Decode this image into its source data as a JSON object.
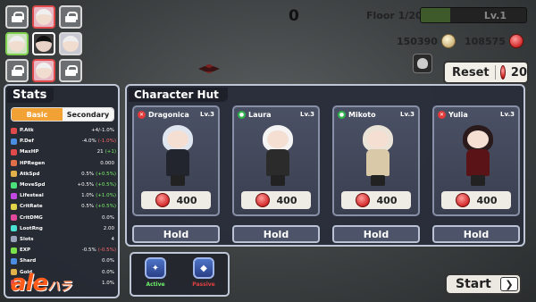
{
  "hud": {
    "score": "0",
    "floor": "Floor 1/20",
    "level": "Lv.1",
    "level_progress": 0.28,
    "gold": "150390",
    "gems": "108575",
    "reset_label": "Reset",
    "reset_cost": "20"
  },
  "squad": [
    {
      "type": "locked"
    },
    {
      "type": "hero",
      "tint": "r"
    },
    {
      "type": "locked"
    },
    {
      "type": "hero",
      "tint": "g"
    },
    {
      "type": "hero",
      "tint": "k"
    },
    {
      "type": "hero",
      "tint": "w"
    },
    {
      "type": "locked"
    },
    {
      "type": "hero",
      "tint": "r"
    },
    {
      "type": "locked"
    }
  ],
  "stats": {
    "title": "Stats",
    "tabs": {
      "basic": "Basic",
      "secondary": "Secondary"
    },
    "rows": [
      {
        "name": "P.Atk",
        "value": "+4/-1.0%",
        "delta": "",
        "color": "#e14a4a"
      },
      {
        "name": "P.Def",
        "value": "-4.0%",
        "delta": "(-1.0%)",
        "color": "#4a8de1"
      },
      {
        "name": "MaxHP",
        "value": "21",
        "delta": "(+1)",
        "pos": true,
        "color": "#e14a4a"
      },
      {
        "name": "HPRegen",
        "value": "0.000",
        "delta": "",
        "color": "#e1704a"
      },
      {
        "name": "AtkSpd",
        "value": "0.5%",
        "delta": "(+0.5%)",
        "pos": true,
        "color": "#e1b14a"
      },
      {
        "name": "MoveSpd",
        "value": "+0.5%",
        "delta": "(+0.5%)",
        "pos": true,
        "color": "#4ae17a"
      },
      {
        "name": "Lifesteal",
        "value": "1.0%",
        "delta": "(+1.0%)",
        "pos": true,
        "color": "#c04ae1"
      },
      {
        "name": "CritRate",
        "value": "0.5%",
        "delta": "(+0.5%)",
        "pos": true,
        "color": "#e1d44a"
      },
      {
        "name": "CritDMG",
        "value": "0.0%",
        "delta": "",
        "color": "#e14a9a"
      },
      {
        "name": "LootRng",
        "value": "2.00",
        "delta": "",
        "color": "#4ae1d4"
      },
      {
        "name": "Slots",
        "value": "4",
        "delta": "",
        "color": "#9aa3b8"
      },
      {
        "name": "EXP",
        "value": "-0.5%",
        "delta": "(-0.5%)",
        "color": "#7ae14a"
      },
      {
        "name": "Shard",
        "value": "0.0%",
        "delta": "",
        "color": "#4a8de1"
      },
      {
        "name": "Gold",
        "value": "0.0%",
        "delta": "",
        "color": "#e1b14a"
      },
      {
        "name": "Gems",
        "value": "1.0%",
        "delta": "",
        "color": "#e14a4a"
      }
    ]
  },
  "hut": {
    "title": "Character Hut",
    "characters": [
      {
        "name": "Dragonica",
        "level": "Lv.3",
        "price": "400",
        "badge": "red",
        "hair": "#dfe6f0",
        "body": "#22252e",
        "hold": "Hold"
      },
      {
        "name": "Laura",
        "level": "Lv.3",
        "price": "400",
        "badge": "green",
        "hair": "#f4f4f4",
        "body": "#2b2b2b",
        "hold": "Hold"
      },
      {
        "name": "Mikoto",
        "level": "Lv.3",
        "price": "400",
        "badge": "green",
        "hair": "#eae3d7",
        "body": "#d9c9a8",
        "hold": "Hold"
      },
      {
        "name": "Yulia",
        "level": "Lv.3",
        "price": "400",
        "badge": "red",
        "hair": "#2a1a1c",
        "body": "#5a1418",
        "hold": "Hold"
      }
    ]
  },
  "skills": [
    {
      "label": "Active",
      "state": "on",
      "glyph": "✦"
    },
    {
      "label": "Passive",
      "state": "off",
      "glyph": "◆"
    }
  ],
  "start_label": "Start",
  "watermark": {
    "main": "ale",
    "sub": "ハラ"
  }
}
